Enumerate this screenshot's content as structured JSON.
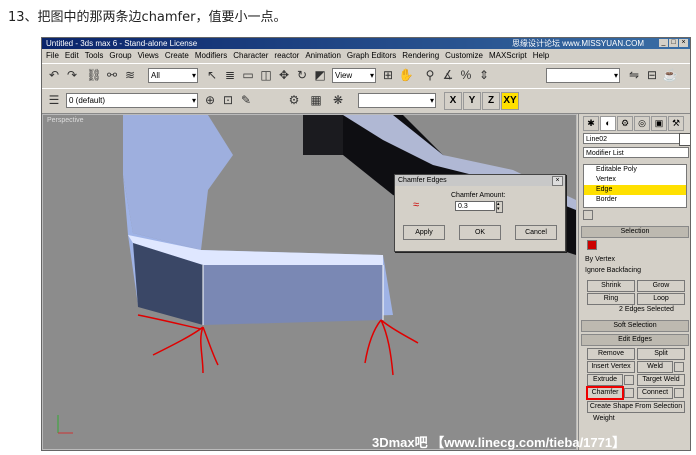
{
  "caption": "13、把图中的那两条边chamfer，值要小一点。",
  "window": {
    "title": "Untitled - 3ds max 6 - Stand-alone License",
    "watermark": "思缘设计论坛 www.MISSYUAN.COM"
  },
  "menu": [
    "File",
    "Edit",
    "Tools",
    "Group",
    "Views",
    "Create",
    "Modifiers",
    "Character",
    "reactor",
    "Animation",
    "Graph Editors",
    "Rendering",
    "Customize",
    "MAXScript",
    "Help"
  ],
  "toolbar1": {
    "selection_filter": "All",
    "coord_system": "View"
  },
  "toolbar2": {
    "layer": "0 (default)",
    "axis": [
      "X",
      "Y",
      "Z",
      "XY"
    ]
  },
  "viewport": {
    "label": "Perspective"
  },
  "chamfer_dialog": {
    "title": "Chamfer Edges",
    "label": "Chamfer Amount:",
    "value": "0.3",
    "apply": "Apply",
    "ok": "OK",
    "cancel": "Cancel"
  },
  "command_panel": {
    "object_name": "Line02",
    "modifier_list": "Modifier List",
    "stack": [
      "Editable Poly",
      "Vertex",
      "Edge",
      "Border"
    ],
    "stack_selected": 2,
    "selection_rollup": "Selection",
    "by_vertex": "By Vertex",
    "ignore_backfacing": "Ignore Backfacing",
    "shrink": "Shrink",
    "grow": "Grow",
    "ring": "Ring",
    "loop": "Loop",
    "edges_selected": "2 Edges Selected",
    "soft_selection": "Soft Selection",
    "edit_edges": "Edit Edges",
    "remove": "Remove",
    "split": "Split",
    "insert_vertex": "Insert Vertex",
    "weld": "Weld",
    "extrude": "Extrude",
    "target_weld": "Target Weld",
    "chamfer": "Chamfer",
    "connect": "Connect",
    "create_shape": "Create Shape From Selection",
    "weight": "Weight"
  },
  "overlay_watermark": "3Dmax吧 【www.linecg.com/tieba/1771】"
}
